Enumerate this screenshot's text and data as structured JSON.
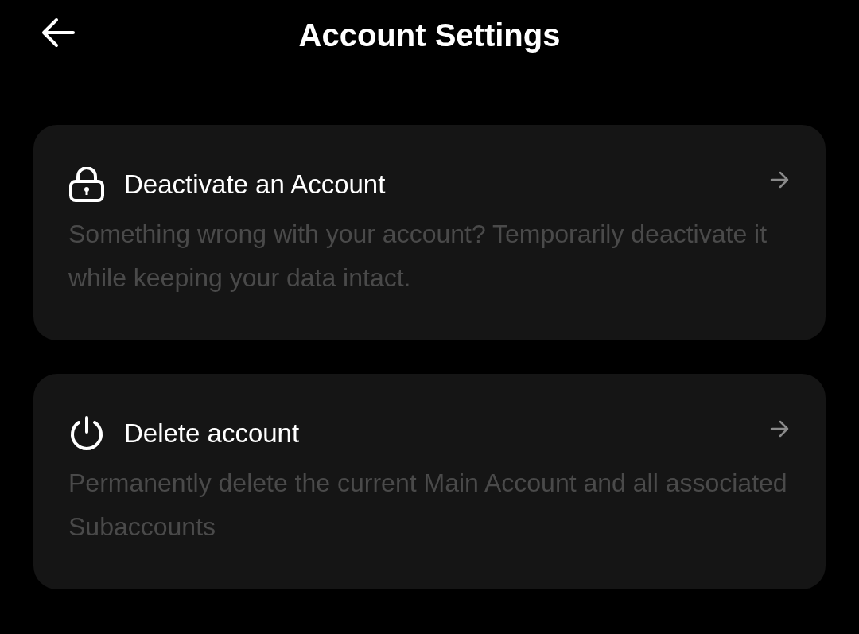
{
  "header": {
    "title": "Account Settings"
  },
  "options": [
    {
      "kind": "lock",
      "title": "Deactivate an Account",
      "description": "Something wrong with your account? Temporarily deactivate it while keeping your data intact."
    },
    {
      "kind": "power",
      "title": "Delete account",
      "description": "Permanently delete the current Main Account and all associated Subaccounts"
    }
  ]
}
